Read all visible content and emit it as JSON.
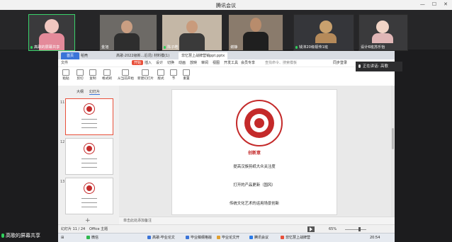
{
  "window": {
    "title": "腾讯会议"
  },
  "participants": [
    {
      "name": "高歌的屏幕共享",
      "mic": true
    },
    {
      "name": "金旭",
      "mic": false
    },
    {
      "name": "陈子皓",
      "mic": true
    },
    {
      "name": "谢静",
      "mic": false
    },
    {
      "name": "钱沛20级视传1班",
      "mic": true
    },
    {
      "name": "设计6班苏乐怡",
      "mic": false
    }
  ],
  "speaking_badge": "正在讲话: 高歌",
  "share_badge": "高歌的屏幕共享",
  "app": {
    "tabs": [
      "首页",
      "稻壳",
      "高歌-2022级新…近况) 材料模(1)",
      "非忆慧上战牌营销ppt.pptx"
    ],
    "menu": [
      "文件",
      "开始",
      "插入",
      "设计",
      "切换",
      "动画",
      "放映",
      "审阅",
      "视图",
      "开发工具",
      "会员专享",
      "查找命令、搜索模板",
      "同步登录"
    ],
    "ribbon": [
      "粘贴",
      "剪切",
      "复制",
      "格式刷",
      "从当前开始",
      "新建幻灯片",
      "版式",
      "节",
      "重置"
    ],
    "side_tabs": [
      "大纲",
      "幻灯片"
    ],
    "thumbs": [
      {
        "num": "11"
      },
      {
        "num": "12"
      },
      {
        "num": "13"
      }
    ],
    "slide": {
      "brand": "创新意",
      "lines": [
        "提高汉族剪纸大众关注度",
        "打开的产品更新（国风）",
        "传统文化艺术的运用场景创新"
      ]
    },
    "notes_placeholder": "单击此处添加备注",
    "status": {
      "slide_index": "幻灯片 11 / 24",
      "theme": "Office 主题",
      "zoom": "65%"
    }
  },
  "taskbar": [
    "微信",
    "高歌-毕业论文",
    "毕业稿纲格版",
    "毕业论文开",
    "腾讯会议",
    "非忆慧上战牌营",
    "20:54"
  ]
}
